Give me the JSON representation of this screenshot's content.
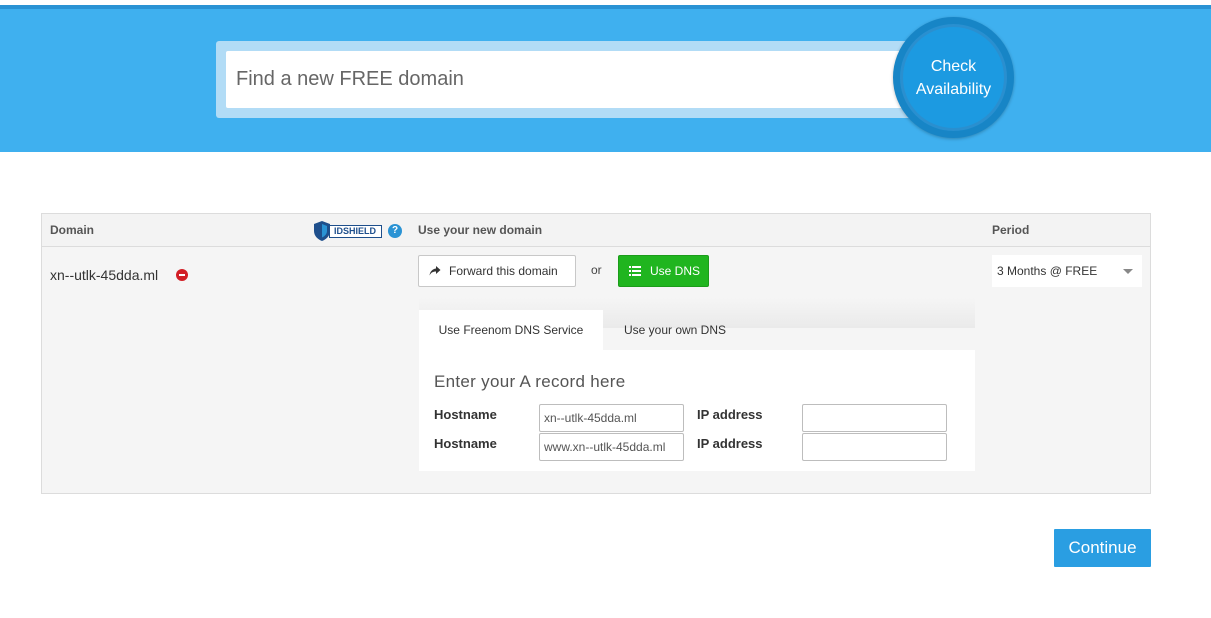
{
  "search": {
    "placeholder": "Find a new FREE domain",
    "check_label_line1": "Check",
    "check_label_line2": "Availability"
  },
  "table": {
    "headers": {
      "domain": "Domain",
      "use_domain": "Use your new domain",
      "period": "Period"
    },
    "idshield_label": "IDSHIELD",
    "help_symbol": "?",
    "row": {
      "domain": "xn--utlk-45dda.ml",
      "forward_label": "Forward this domain",
      "or_text": "or",
      "use_dns_label": "Use DNS",
      "period_value": "3 Months @ FREE"
    }
  },
  "dns": {
    "tabs": [
      {
        "label": "Use Freenom DNS Service",
        "active": true
      },
      {
        "label": "Use your own DNS",
        "active": false
      }
    ],
    "record_title": "Enter your A record here",
    "rows": [
      {
        "hostname_label": "Hostname",
        "hostname_value": "xn--utlk-45dda.ml",
        "ip_label": "IP address",
        "ip_value": ""
      },
      {
        "hostname_label": "Hostname",
        "hostname_value": "www.xn--utlk-45dda.ml",
        "ip_label": "IP address",
        "ip_value": ""
      }
    ]
  },
  "continue_label": "Continue",
  "icons": {
    "remove": "remove-icon",
    "forward": "share-arrow-icon",
    "dns": "list-icon",
    "help": "question-circle-icon",
    "shield": "shield-icon",
    "caret": "caret-down-icon"
  },
  "colors": {
    "banner": "#3fb0ef",
    "check_button": "#1c9ae1",
    "dns_button": "#20b51f",
    "continue_button": "#2a9ee2",
    "remove": "#d21f26"
  }
}
